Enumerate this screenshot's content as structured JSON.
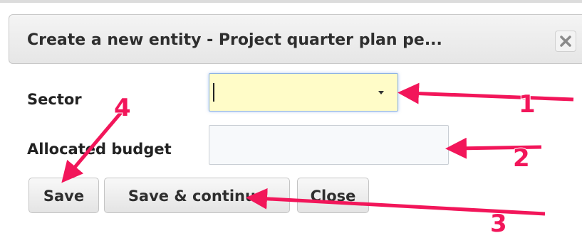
{
  "dialog": {
    "title": "Create a new entity - Project quarter plan pe...",
    "close_icon": "close-x-icon"
  },
  "form": {
    "sector": {
      "label": "Sector",
      "value": "",
      "dropdown_icon": "caret-down-icon"
    },
    "allocated_budget": {
      "label": "Allocated budget",
      "value": "",
      "placeholder": ""
    }
  },
  "buttons": {
    "save": "Save",
    "save_continue": "Save & continue",
    "close": "Close"
  },
  "annotations": {
    "color": "#f2165a",
    "callouts": [
      {
        "number": "1",
        "target": "sector dropdown"
      },
      {
        "number": "2",
        "target": "allocated budget input"
      },
      {
        "number": "3",
        "target": "save & continue button"
      },
      {
        "number": "4",
        "target": "save button"
      }
    ]
  }
}
